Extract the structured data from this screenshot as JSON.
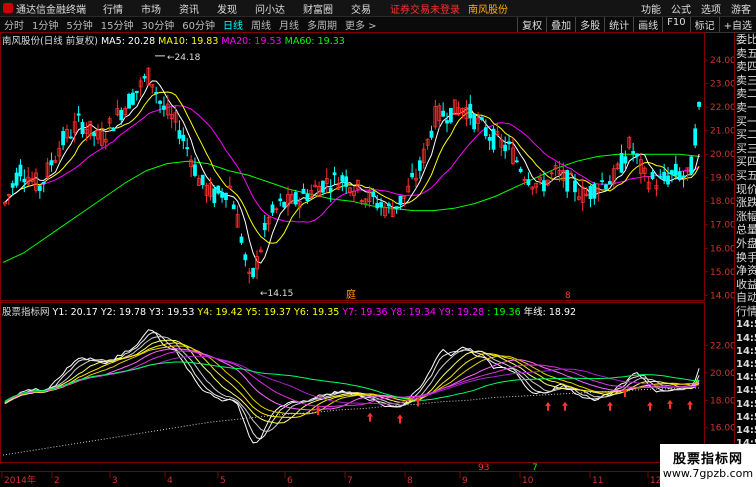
{
  "topbar": {
    "app_name": "通达信金融终端",
    "menus": [
      "行情",
      "市场",
      "资讯",
      "发现",
      "问小达",
      "财富圈",
      "交易"
    ],
    "warning": "证券交易未登录",
    "stock_name": "南风股份",
    "right_items": [
      "功能",
      "公式",
      "选项",
      "游客"
    ]
  },
  "toolbar": {
    "timeframes": [
      "分时",
      "1分钟",
      "5分钟",
      "15分钟",
      "30分钟",
      "60分钟",
      "日线",
      "周线",
      "月线",
      "多周期",
      "更多 >"
    ],
    "active": "日线",
    "right_buttons": [
      "复权",
      "叠加",
      "多股",
      "统计",
      "画线",
      "F10",
      "标记",
      "+自选"
    ]
  },
  "main_header": {
    "title": "南风股份(日线 前复权)",
    "ma": [
      {
        "label": "MA5: 20.28",
        "color": "#ffffff"
      },
      {
        "label": "MA10: 19.83",
        "color": "#ffff00"
      },
      {
        "label": "MA20: 19.53",
        "color": "#ff00ff"
      },
      {
        "label": "MA60: 19.33",
        "color": "#00ff00"
      }
    ]
  },
  "indicator_header": {
    "title": "股票指标网",
    "lines": [
      {
        "label": "Y1: 20.17",
        "color": "#ffffff"
      },
      {
        "label": "Y2: 19.78",
        "color": "#ffffff"
      },
      {
        "label": "Y3: 19.53",
        "color": "#ffffff"
      },
      {
        "label": "Y4: 19.42",
        "color": "#ffff00"
      },
      {
        "label": "Y5: 19.37",
        "color": "#ffff00"
      },
      {
        "label": "Y6: 19.35",
        "color": "#ffff00"
      },
      {
        "label": "Y7: 19.36",
        "color": "#ff00ff"
      },
      {
        "label": "Y8: 19.34",
        "color": "#ff00ff"
      },
      {
        "label": "Y9: 19.28",
        "color": "#ff00ff"
      },
      {
        "label": ": 19.36",
        "color": "#00ff00"
      },
      {
        "label": "年线: 18.92",
        "color": "#ffffff"
      }
    ]
  },
  "side_panel": [
    "委比",
    "卖五",
    "卖四",
    "卖三",
    "卖二",
    "卖一",
    "买一",
    "买二",
    "买三",
    "买四",
    "买五",
    "现价",
    "涨跌",
    "涨幅",
    "总量",
    "外盘",
    "换手",
    "净资",
    "收益",
    "自动",
    "行情",
    "14:56",
    "14:56",
    "14:56",
    "14:56",
    "14:56",
    "14:56",
    "14:56",
    "14:56",
    "14:56",
    "14:56",
    "14:56"
  ],
  "main_axis": [
    "24.00",
    "23.00",
    "22.00",
    "21.00",
    "20.00",
    "19.00",
    "18.00",
    "17.00",
    "16.00",
    "15.00",
    "14.00"
  ],
  "ind_axis": [
    "22.00",
    "20.00",
    "18.00",
    "16.00",
    "14.00"
  ],
  "x_axis": [
    "2014年",
    "2",
    "3",
    "4",
    "5",
    "6",
    "7",
    "8",
    "9",
    "10",
    "11",
    "12"
  ],
  "annotations": {
    "high": "24.18",
    "low": "14.15",
    "event_a": "庭",
    "event_b": "8",
    "vol_a": "93",
    "vol_b": "7"
  },
  "watermark": {
    "line1": "股票指标网",
    "line2": "www.7gpzb.com"
  },
  "colors": {
    "up": "#ff3030",
    "down": "#00ffff",
    "ma5": "#ffffff",
    "ma10": "#ffff00",
    "ma20": "#ff00ff",
    "ma60": "#00ff00",
    "axis": "#800000"
  },
  "chart_data": {
    "type": "candlestick",
    "ylim": [
      13.8,
      24.6
    ],
    "ma60": [
      15.4,
      15.8,
      16.4,
      17.0,
      17.6,
      18.2,
      18.8,
      19.3,
      19.6,
      19.7,
      19.6,
      19.3,
      19.1,
      18.8,
      18.5,
      18.3,
      18.1,
      18.0,
      17.8,
      17.7,
      17.6,
      17.6,
      17.7,
      17.9,
      18.2,
      18.6,
      19.0,
      19.4,
      19.7,
      19.9,
      20.0,
      20.0,
      20.0,
      20.0,
      19.9
    ],
    "ma20": [
      19.0,
      19.4,
      19.9,
      20.6,
      21.6,
      22.4,
      23.0,
      23.0,
      22.4,
      21.4,
      20.0,
      18.4,
      17.0,
      16.2,
      16.6,
      17.4,
      18.1,
      18.5,
      18.4,
      18.0,
      17.8,
      18.0,
      18.8,
      20.0,
      21.4,
      22.0,
      21.8,
      21.0,
      20.3,
      20.0,
      20.0,
      19.8,
      19.7,
      19.5,
      19.5
    ],
    "ma10": [
      19.6,
      20.2,
      20.8,
      21.4,
      22.4,
      23.2,
      23.6,
      23.2,
      22.0,
      20.4,
      19.0,
      17.4,
      16.0,
      15.6,
      16.6,
      17.8,
      18.6,
      18.8,
      18.2,
      17.4,
      17.4,
      18.2,
      19.6,
      21.0,
      22.0,
      21.8,
      21.0,
      20.0,
      19.6,
      19.4,
      19.8,
      19.6,
      19.6,
      19.4,
      19.8
    ],
    "indicator_ylim": [
      13.5,
      24.0
    ],
    "year_line": [
      14.0,
      14.3,
      14.6,
      14.9,
      15.2,
      15.5,
      15.8,
      16.1,
      16.4,
      16.6,
      16.8,
      17.0,
      17.1,
      17.3,
      17.4,
      17.6,
      17.7,
      17.9,
      18.0,
      18.2,
      18.3,
      18.4,
      18.5,
      18.6,
      18.7,
      18.8,
      18.85,
      18.9
    ],
    "signal_count": 10
  }
}
